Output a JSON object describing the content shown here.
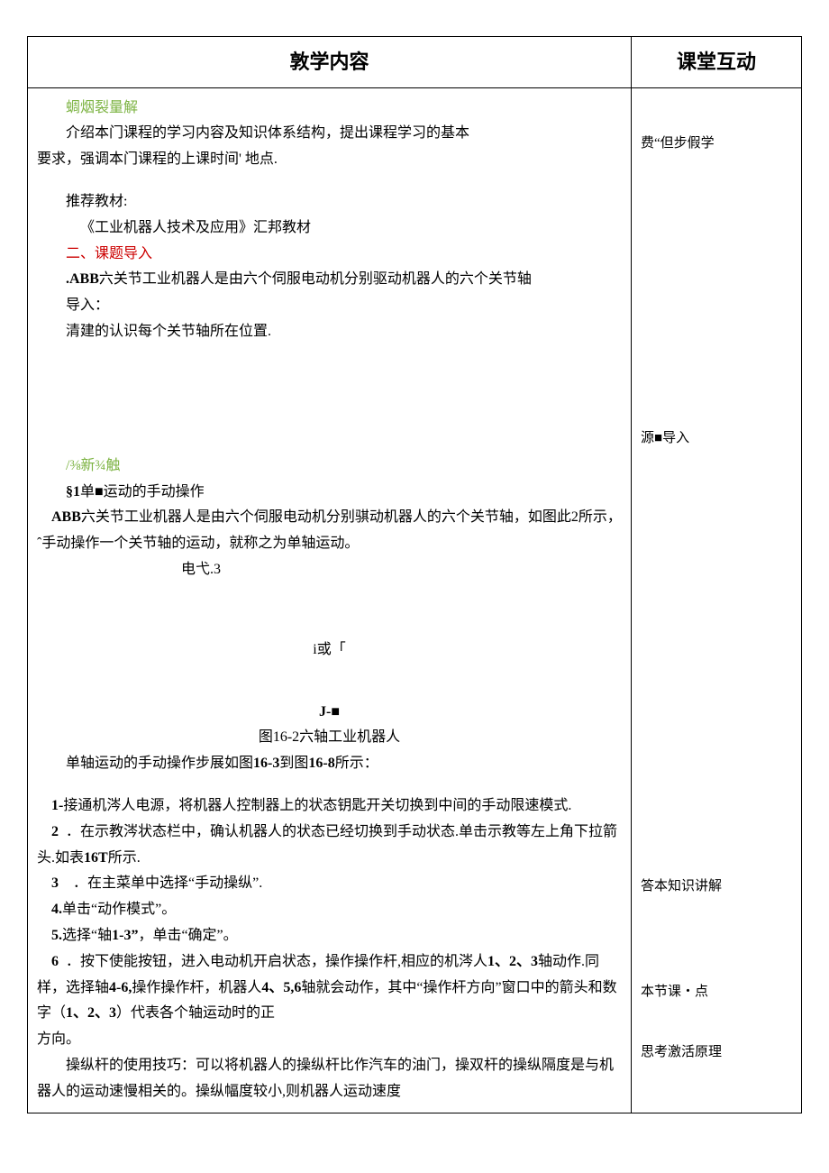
{
  "header": {
    "col_main": "敦学内容",
    "col_side": "课堂互动"
  },
  "side": {
    "note1": "费“但步假学",
    "note2": "源■导入",
    "note3": "答本知识讲解",
    "note4": "本节课・点",
    "note5": "思考激活原理"
  },
  "s1": {
    "title": "蜩烟裂量解",
    "p1": "介绍本门课程的学习内容及知识体系结构，提出课程学习的基本",
    "p1b": "要求，强调本门课程的上课时间' 地点.",
    "rec_label": "推荐教材:",
    "rec_book": "《工业机器人技术及应用》汇邦教材"
  },
  "s2": {
    "title": "二、课题导入",
    "p1_prefix": ".ABB",
    "p1_rest": "六关节工业机器人是由六个伺服电动机分别驱动机器人的六个关节轴",
    "lead": "导入：",
    "p2": "清建的认识每个关节轴所在位置."
  },
  "s3": {
    "title": "/⅜新¾触",
    "h1_prefix": "§1",
    "h1_rest": "单■运动的手动操作",
    "p1_prefix": "ABB",
    "p1_rest": "六关节工业机器人是由六个伺服电动机分别骐动机器人的六个关节轴，如图此2所示，ˆ手动操作一个关节轴的运动，就称之为单轴运动。",
    "dian": "电弋.3",
    "fig_a": "i或「",
    "fig_b": "J-■",
    "caption": "图16-2六轴工业机器人",
    "p2_a": "单轴运动的手动操作步展如图",
    "p2_b": "16-3",
    "p2_c": "到图",
    "p2_d": "16-8",
    "p2_e": "所示：",
    "step1_n": "1-",
    "step1": "接通机涔人电源，将机器人控制器上的状态钥匙开关切换到中间的手动限速模式.",
    "step2_n": "2",
    "step2_a": "．在示教涔状态栏中，确认机器人的状态已经切换到手动状态.单击示教等左上角下拉箭头.如表",
    "step2_b": "16T",
    "step2_c": "所示.",
    "step3_n": "3",
    "step3": "．在主菜单中选择“手动操纵”.",
    "step4_n": "4.",
    "step4": "单击“动作模式”。",
    "step5_n": "5.",
    "step5_a": "选择“轴",
    "step5_b": "1-3”",
    "step5_c": "，单击“确定”。",
    "step6_n": "6",
    "step6_a": "．按下使能按钮，进入电动机开启状态，操作操作杆,相应的机涔人",
    "step6_b": "1、2、3",
    "step6_c": "轴动作.同样，选择轴",
    "step6_d": "4-6,",
    "step6_e": "操作操作杆，机器人",
    "step6_f": "4、5,6",
    "step6_g": "轴就会动作，其中“操作杆方向”窗口中的箭头和数字（",
    "step6_h": "1、2、3",
    "step6_i": "）代表各个轴运动时的正",
    "step6_j": "方向。",
    "tip": "操纵杆的使用技巧：可以将机器人的操纵杆比作汽车的油门，操双杆的操纵隔度是与机器人的运动速慢相关的。操纵幅度较小,则机器人运动速度"
  }
}
